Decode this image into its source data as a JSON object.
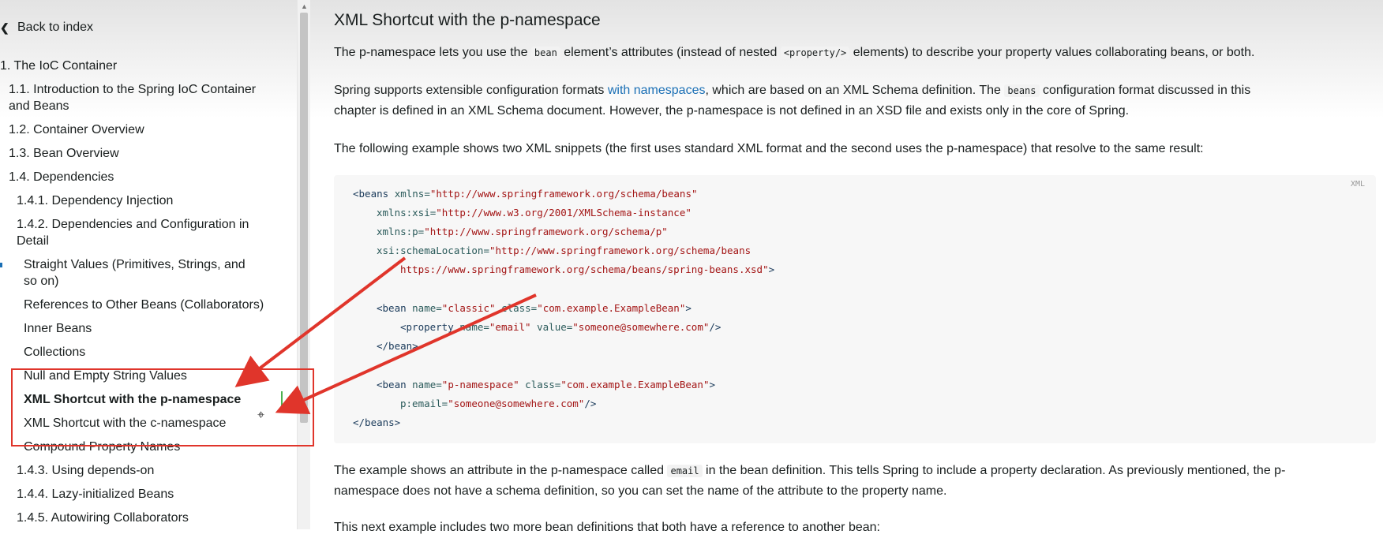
{
  "sidebar": {
    "back_label": "Back to index",
    "items": [
      {
        "label": "1. The IoC Container",
        "level": 0
      },
      {
        "label": "1.1. Introduction to the Spring IoC Container",
        "label2": "and Beans",
        "level": 1
      },
      {
        "label": "1.2. Container Overview",
        "level": 1
      },
      {
        "label": "1.3. Bean Overview",
        "level": 1
      },
      {
        "label": "1.4. Dependencies",
        "level": 1
      },
      {
        "label": "1.4.1. Dependency Injection",
        "level": 2
      },
      {
        "label": "1.4.2. Dependencies and Configuration in",
        "label2": "Detail",
        "level": 2
      },
      {
        "label": "Straight Values (Primitives, Strings, and",
        "label2": "so on)",
        "level": 3
      },
      {
        "label": "References to Other Beans (Collaborators)",
        "level": 3
      },
      {
        "label": "Inner Beans",
        "level": 3
      },
      {
        "label": "Collections",
        "level": 3
      },
      {
        "label": "Null and Empty String Values",
        "level": 3
      },
      {
        "label": "XML Shortcut with the p-namespace",
        "level": 3,
        "active": true
      },
      {
        "label": "XML Shortcut with the c-namespace",
        "level": 3
      },
      {
        "label": "Compound Property Names",
        "level": 3
      },
      {
        "label": "1.4.3. Using depends-on",
        "level": 2
      },
      {
        "label": "1.4.4. Lazy-initialized Beans",
        "level": 2
      },
      {
        "label": "1.4.5. Autowiring Collaborators",
        "level": 2
      }
    ]
  },
  "main": {
    "title": "XML Shortcut with the p-namespace",
    "p1": {
      "a": "The p-namespace lets you use the ",
      "code1": "bean",
      "b": " element’s attributes (instead of nested ",
      "code2": "<property/>",
      "c": " elements) to describe your property values collaborating beans, or both."
    },
    "p2": {
      "a": "Spring supports extensible configuration formats ",
      "link": "with namespaces",
      "b": ", which are based on an XML Schema definition. The ",
      "code": "beans",
      "c": " configuration format discussed in this",
      "line2": "chapter is defined in an XML Schema document. However, the p-namespace is not defined in an XSD file and exists only in the core of Spring."
    },
    "p3": "The following example shows two XML snippets (the first uses standard XML format and the second uses the p-namespace) that resolve to the same result:",
    "code": {
      "lang": "XML",
      "l1_tag": "<beans ",
      "l1_attr": "xmlns=",
      "l1_str": "\"http://www.springframework.org/schema/beans\"",
      "l2_attr": "xmlns:xsi=",
      "l2_str": "\"http://www.w3.org/2001/XMLSchema-instance\"",
      "l3_attr": "xmlns:p=",
      "l3_str": "\"http://www.springframework.org/schema/p\"",
      "l4_attr": "xsi:schemaLocation=",
      "l4_str": "\"http://www.springframework.org/schema/beans",
      "l5_str": "https://www.springframework.org/schema/beans/spring-beans.xsd\"",
      "l5_tag": ">",
      "l6_tag": "<bean ",
      "l6_attr1": "name=",
      "l6_str1": "\"classic\"",
      "l6_attr2": " class=",
      "l6_str2": "\"com.example.ExampleBean\"",
      "l6_end": ">",
      "l7_tag": "<property ",
      "l7_attr1": "name=",
      "l7_str1": "\"email\"",
      "l7_attr2": " value=",
      "l7_str2": "\"someone@somewhere.com\"",
      "l7_end": "/>",
      "l8": "</bean>",
      "l9_tag": "<bean ",
      "l9_attr1": "name=",
      "l9_str1": "\"p-namespace\"",
      "l9_attr2": " class=",
      "l9_str2": "\"com.example.ExampleBean\"",
      "l9_end": ">",
      "l10_attr": "p:email=",
      "l10_str": "\"someone@somewhere.com\"",
      "l10_end": "/>",
      "l11": "</beans>"
    },
    "p4_line1": "The example shows an attribute in the p-namespace called ",
    "p4_code": "email",
    "p4_line1b": " in the bean definition. This tells Spring to include a property declaration. As previously mentioned, the p-",
    "p4_line2": "namespace does not have a schema definition, so you can set the name of the attribute to the property name.",
    "p5": "This next example includes two more bean definitions that both have a reference to another bean:"
  },
  "colors": {
    "annotation": "#e0352b",
    "link": "#1a6fb5"
  }
}
